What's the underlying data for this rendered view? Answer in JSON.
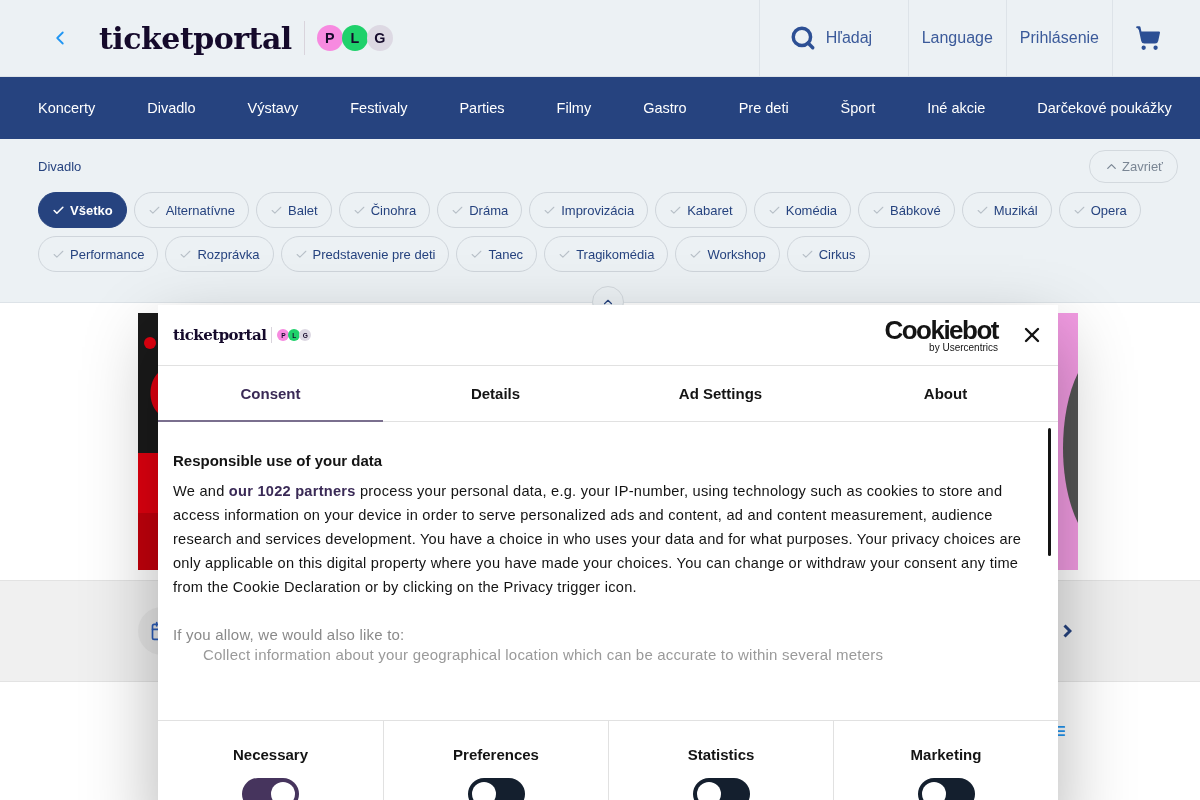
{
  "header": {
    "logo": "ticketportal",
    "badges": [
      {
        "letter": "P",
        "color": "#f78ae0"
      },
      {
        "letter": "L",
        "color": "#1fd16b"
      },
      {
        "letter": "G",
        "color": "#ddd9e3"
      }
    ],
    "search": "Hľadaj",
    "language": "Language",
    "login": "Prihlásenie"
  },
  "nav": [
    "Koncerty",
    "Divadlo",
    "Výstavy",
    "Festivaly",
    "Parties",
    "Filmy",
    "Gastro",
    "Pre deti",
    "Šport",
    "Iné akcie",
    "Darčekové poukážky"
  ],
  "filters": {
    "title": "Divadlo",
    "close": "Zavrieť",
    "chips": [
      {
        "label": "Všetko",
        "selected": true
      },
      {
        "label": "Alternatívne",
        "selected": false
      },
      {
        "label": "Balet",
        "selected": false
      },
      {
        "label": "Činohra",
        "selected": false
      },
      {
        "label": "Dráma",
        "selected": false
      },
      {
        "label": "Improvizácia",
        "selected": false
      },
      {
        "label": "Kabaret",
        "selected": false
      },
      {
        "label": "Komédia",
        "selected": false
      },
      {
        "label": "Bábkové",
        "selected": false
      },
      {
        "label": "Muzikál",
        "selected": false
      },
      {
        "label": "Opera",
        "selected": false
      },
      {
        "label": "Performance",
        "selected": false
      },
      {
        "label": "Rozprávka",
        "selected": false
      },
      {
        "label": "Predstavenie pre deti",
        "selected": false
      },
      {
        "label": "Tanec",
        "selected": false
      },
      {
        "label": "Tragikomédia",
        "selected": false
      },
      {
        "label": "Workshop",
        "selected": false
      },
      {
        "label": "Cirkus",
        "selected": false
      }
    ]
  },
  "consent": {
    "logo": "ticketportal",
    "badges": [
      {
        "letter": "P",
        "color": "#f78ae0"
      },
      {
        "letter": "L",
        "color": "#1fd16b"
      },
      {
        "letter": "G",
        "color": "#ddd9e3"
      }
    ],
    "provider": "Cookiebot",
    "provider_sub": "by Usercentrics",
    "tabs": [
      {
        "label": "Consent",
        "selected": true
      },
      {
        "label": "Details",
        "selected": false
      },
      {
        "label": "Ad Settings",
        "selected": false
      },
      {
        "label": "About",
        "selected": false
      }
    ],
    "heading": "Responsible use of your data",
    "body": "We and **our 1022 partners** process your personal data, e.g. your IP-number, using technology such as cookies to store and access information on your device in order to serve personalized ads and content, ad and content measurement, audience research and services development. You have a choice in who uses your data and for what purposes. Your privacy choices are only applicable on this digital property where you have made your choices. You can change or withdraw your consent any time from the Cookie Declaration or by clicking on the Privacy trigger icon.",
    "allow_intro": "If you allow, we would also like to:",
    "allow_items": [
      "Collect information about your geographical location which can be accurate to within several meters"
    ],
    "categories": [
      {
        "label": "Necessary",
        "on": true
      },
      {
        "label": "Preferences",
        "on": false
      },
      {
        "label": "Statistics",
        "on": false
      },
      {
        "label": "Marketing",
        "on": false
      }
    ]
  }
}
